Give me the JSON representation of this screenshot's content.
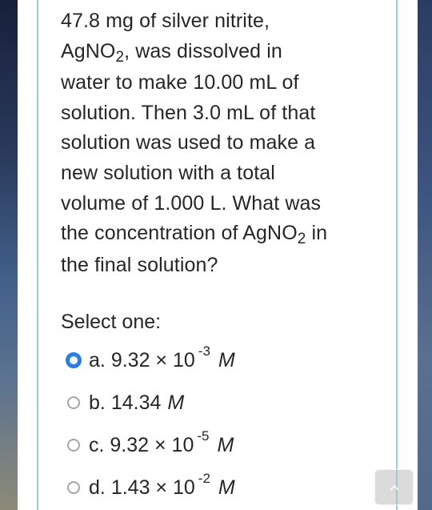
{
  "question": {
    "lines": [
      {
        "pre": "47.8 mg of silver nitrite,",
        "sub": "",
        "post": ""
      },
      {
        "pre": "AgNO",
        "sub": "2",
        "post": ", was dissolved in"
      },
      {
        "pre": "water to make 10.00 mL of",
        "sub": "",
        "post": ""
      },
      {
        "pre": "solution. Then 3.0 mL of that",
        "sub": "",
        "post": ""
      },
      {
        "pre": "solution was used to make a",
        "sub": "",
        "post": ""
      },
      {
        "pre": "new solution with a total",
        "sub": "",
        "post": ""
      },
      {
        "pre": "volume of 1.000 L. What was",
        "sub": "",
        "post": ""
      },
      {
        "pre": "the concentration of AgNO",
        "sub": "2",
        "post": " in"
      },
      {
        "pre": "the final solution?",
        "sub": "",
        "post": ""
      }
    ]
  },
  "select_label": "Select one:",
  "options": [
    {
      "letter": "a.",
      "value": "9.32 × 10",
      "exponent": "-3",
      "unit": "M",
      "selected": true
    },
    {
      "letter": "b.",
      "value": "14.34",
      "exponent": "",
      "unit": "M",
      "selected": false
    },
    {
      "letter": "c.",
      "value": "9.32 × 10",
      "exponent": "-5",
      "unit": "M",
      "selected": false
    },
    {
      "letter": "d.",
      "value": "1.43 × 10",
      "exponent": "-2",
      "unit": "M",
      "selected": false
    }
  ],
  "colors": {
    "accent": "#2a7de1",
    "box_border": "#8fd0dc",
    "text": "#262626"
  },
  "icons": {
    "scroll_top": "chevron-up-icon"
  }
}
